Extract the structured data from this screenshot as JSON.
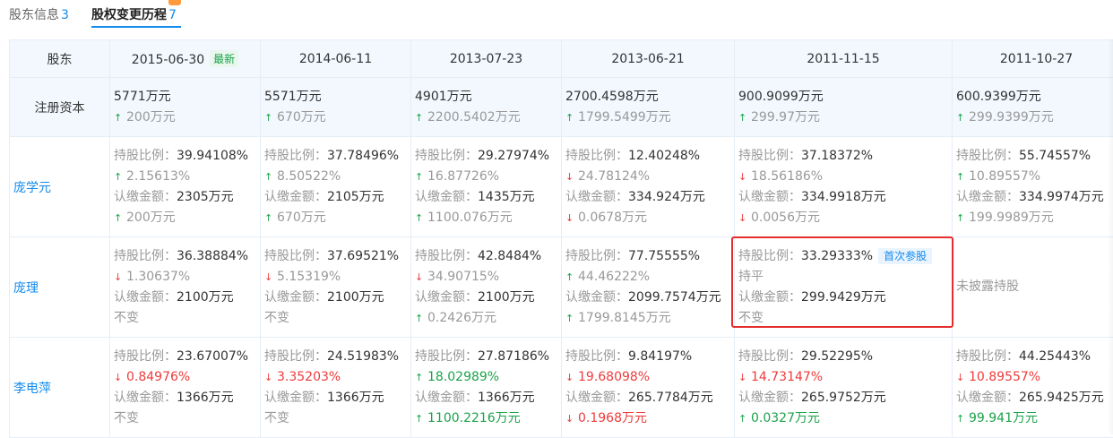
{
  "tabs": [
    {
      "label": "股东信息",
      "count": "3"
    },
    {
      "label": "股权变更历程",
      "count": "7"
    }
  ],
  "header": {
    "label": "股东",
    "dates": [
      "2015-06-30",
      "2014-06-11",
      "2013-07-23",
      "2013-06-21",
      "2011-11-15",
      "2011-10-27"
    ],
    "latest_badge": "最新"
  },
  "registered_capital": {
    "label": "注册资本",
    "cells": [
      {
        "value": "5771万元",
        "change": "200万元",
        "dir": "up"
      },
      {
        "value": "5571万元",
        "change": "670万元",
        "dir": "up"
      },
      {
        "value": "4901万元",
        "change": "2200.5402万元",
        "dir": "up"
      },
      {
        "value": "2700.4598万元",
        "change": "1799.5499万元",
        "dir": "up"
      },
      {
        "value": "900.9099万元",
        "change": "299.97万元",
        "dir": "up"
      },
      {
        "value": "600.9399万元",
        "change": "299.9399万元",
        "dir": "up"
      }
    ]
  },
  "labels": {
    "ratio": "持股比例：",
    "amount": "认缴金额："
  },
  "shareholders": [
    {
      "name": "庞学元",
      "cells": [
        {
          "ratio": "39.94108%",
          "ratio_change": "2.15613%",
          "ratio_dir": "up",
          "ratio_style": "gray",
          "amount": "2305万元",
          "amount_change": "200万元",
          "amount_dir": "up",
          "amount_style": "gray"
        },
        {
          "ratio": "37.78496%",
          "ratio_change": "8.50522%",
          "ratio_dir": "up",
          "ratio_style": "gray",
          "amount": "2105万元",
          "amount_change": "670万元",
          "amount_dir": "up",
          "amount_style": "gray"
        },
        {
          "ratio": "29.27974%",
          "ratio_change": "16.87726%",
          "ratio_dir": "up",
          "ratio_style": "gray",
          "amount": "1435万元",
          "amount_change": "1100.076万元",
          "amount_dir": "up",
          "amount_style": "gray"
        },
        {
          "ratio": "12.40248%",
          "ratio_change": "24.78124%",
          "ratio_dir": "down",
          "ratio_style": "gray",
          "amount": "334.924万元",
          "amount_change": "0.0678万元",
          "amount_dir": "down",
          "amount_style": "gray"
        },
        {
          "ratio": "37.18372%",
          "ratio_change": "18.56186%",
          "ratio_dir": "down",
          "ratio_style": "gray",
          "amount": "334.9918万元",
          "amount_change": "0.0056万元",
          "amount_dir": "down",
          "amount_style": "gray"
        },
        {
          "ratio": "55.74557%",
          "ratio_change": "10.89557%",
          "ratio_dir": "up",
          "ratio_style": "gray",
          "amount": "334.9974万元",
          "amount_change": "199.9989万元",
          "amount_dir": "up",
          "amount_style": "gray"
        }
      ]
    },
    {
      "name": "庞理",
      "cells": [
        {
          "ratio": "36.38884%",
          "ratio_change": "1.30637%",
          "ratio_dir": "down",
          "ratio_style": "gray",
          "amount": "2100万元",
          "amount_change": "不变",
          "amount_dir": "none",
          "amount_style": "gray"
        },
        {
          "ratio": "37.69521%",
          "ratio_change": "5.15319%",
          "ratio_dir": "down",
          "ratio_style": "gray",
          "amount": "2100万元",
          "amount_change": "不变",
          "amount_dir": "none",
          "amount_style": "gray"
        },
        {
          "ratio": "42.8484%",
          "ratio_change": "34.90715%",
          "ratio_dir": "down",
          "ratio_style": "gray",
          "amount": "2100万元",
          "amount_change": "0.2426万元",
          "amount_dir": "up",
          "amount_style": "gray"
        },
        {
          "ratio": "77.75555%",
          "ratio_change": "44.46222%",
          "ratio_dir": "up",
          "ratio_style": "gray",
          "amount": "2099.7574万元",
          "amount_change": "1799.8145万元",
          "amount_dir": "up",
          "amount_style": "gray"
        },
        {
          "ratio": "33.29333%",
          "first_badge": "首次参股",
          "ratio_change": "持平",
          "ratio_dir": "none",
          "ratio_style": "gray",
          "amount": "299.9429万元",
          "amount_change": "不变",
          "amount_dir": "none",
          "amount_style": "gray"
        },
        {
          "undisclosed": "未披露持股"
        }
      ]
    },
    {
      "name": "李电萍",
      "cells": [
        {
          "ratio": "23.67007%",
          "ratio_change": "0.84976%",
          "ratio_dir": "down",
          "ratio_style": "red",
          "amount": "1366万元",
          "amount_change": "不变",
          "amount_dir": "none",
          "amount_style": "gray"
        },
        {
          "ratio": "24.51983%",
          "ratio_change": "3.35203%",
          "ratio_dir": "down",
          "ratio_style": "red",
          "amount": "1366万元",
          "amount_change": "不变",
          "amount_dir": "none",
          "amount_style": "gray"
        },
        {
          "ratio": "27.87186%",
          "ratio_change": "18.02989%",
          "ratio_dir": "up",
          "ratio_style": "green",
          "amount": "1366万元",
          "amount_change": "1100.2216万元",
          "amount_dir": "up",
          "amount_style": "green"
        },
        {
          "ratio": "9.84197%",
          "ratio_change": "19.68098%",
          "ratio_dir": "down",
          "ratio_style": "red",
          "amount": "265.7784万元",
          "amount_change": "0.1968万元",
          "amount_dir": "down",
          "amount_style": "red"
        },
        {
          "ratio": "29.52295%",
          "ratio_change": "14.73147%",
          "ratio_dir": "down",
          "ratio_style": "red",
          "amount": "265.9752万元",
          "amount_change": "0.0327万元",
          "amount_dir": "up",
          "amount_style": "green"
        },
        {
          "ratio": "44.25443%",
          "ratio_change": "10.89557%",
          "ratio_dir": "down",
          "ratio_style": "red",
          "amount": "265.9425万元",
          "amount_change": "99.941万元",
          "amount_dir": "up",
          "amount_style": "green"
        }
      ]
    }
  ],
  "colors": {
    "accent": "#128bed",
    "up": "#1aa34a",
    "down": "#ee3b3b",
    "highlight_border": "#e52d2d"
  },
  "icons": {
    "up": "arrow-up-icon",
    "down": "arrow-down-icon"
  }
}
